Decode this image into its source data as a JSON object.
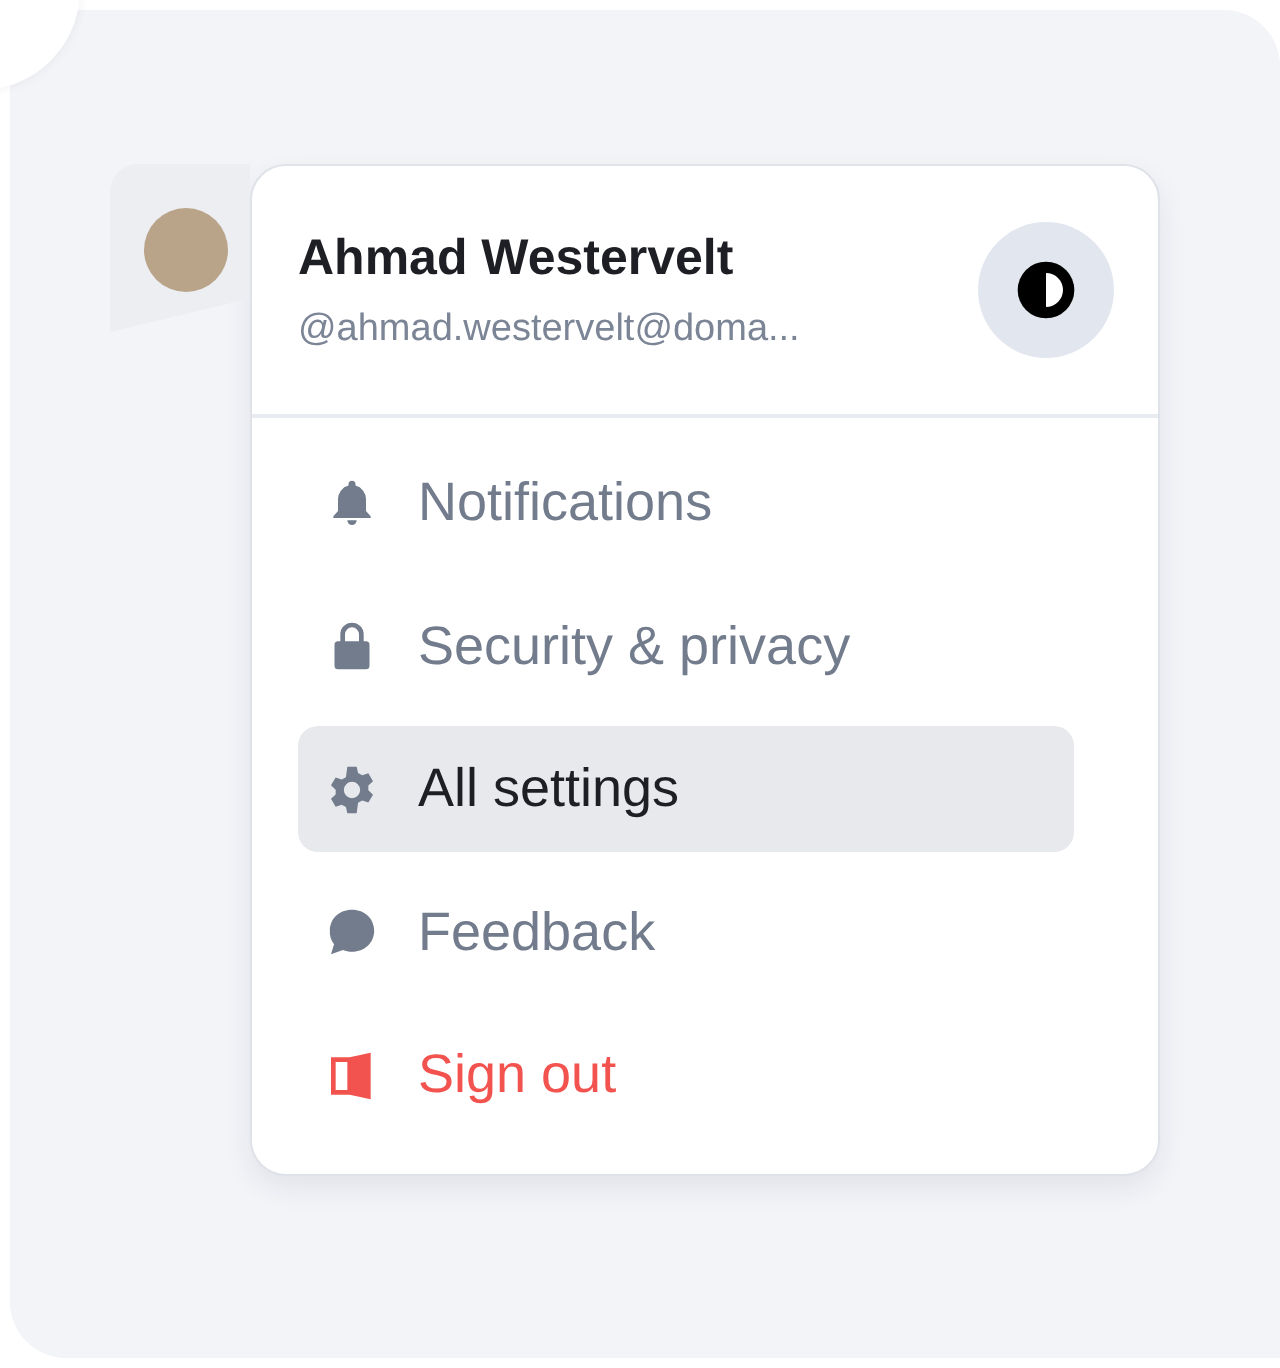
{
  "user": {
    "name": "Ahmad Westervelt",
    "handle": "@ahmad.westervelt@doma..."
  },
  "menu": [
    {
      "kind": "bell",
      "label": "Notifications",
      "selected": false
    },
    {
      "kind": "lock",
      "label": "Security & privacy",
      "selected": false
    },
    {
      "kind": "gear",
      "label": "All settings",
      "selected": true
    },
    {
      "kind": "chat",
      "label": "Feedback",
      "selected": false
    },
    {
      "kind": "signout",
      "label": "Sign out",
      "selected": false
    }
  ]
}
